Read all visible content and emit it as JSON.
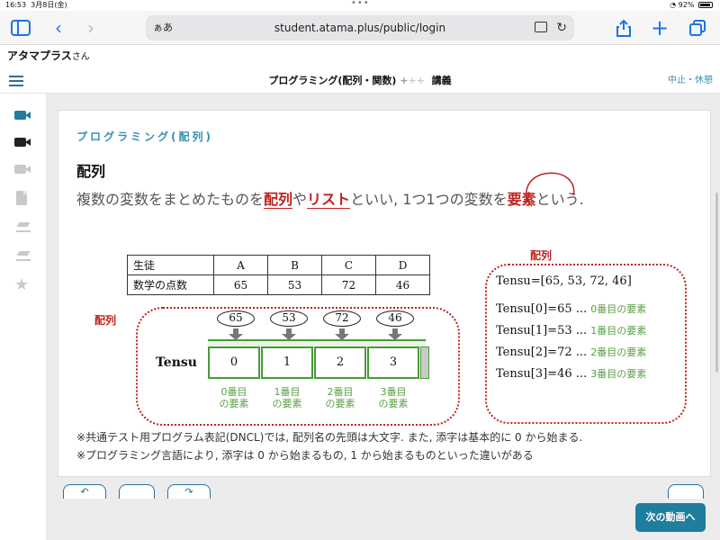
{
  "status_bar": {
    "time": "16:53",
    "date": "3月8日(金)",
    "battery": "92%"
  },
  "browser": {
    "aa_label": "ぁあ",
    "url": "student.atama.plus/public/login"
  },
  "user": {
    "name": "アタマプラス",
    "suffix": "さん"
  },
  "header": {
    "title": "プログラミング(配列・関数)",
    "plus1": "+",
    "plus2": "++",
    "type": "講義",
    "pause_label": "中止・休憩"
  },
  "content": {
    "section_label": "プログラミング(配列)",
    "heading": "配列",
    "sentence": {
      "p1": "複数の変数をまとめたものを",
      "array": "配列",
      "p2": "や",
      "list": "リスト",
      "p3": "といい, 1つ1つの変数を",
      "element": "要素",
      "p4": "という."
    },
    "table": {
      "row_label_1": "生徒",
      "row_label_2": "数学の点数",
      "students": [
        "A",
        "B",
        "C",
        "D"
      ],
      "scores": [
        "65",
        "53",
        "72",
        "46"
      ]
    },
    "array_tag_left": "配列",
    "array_tag_right": "配列",
    "array_name": "Tensu",
    "values": [
      "65",
      "53",
      "72",
      "46"
    ],
    "indices": [
      "0",
      "1",
      "2",
      "3"
    ],
    "element_labels": [
      {
        "line1": "0番目",
        "line2": "の要素"
      },
      {
        "line1": "1番目",
        "line2": "の要素"
      },
      {
        "line1": "2番目",
        "line2": "の要素"
      },
      {
        "line1": "3番目",
        "line2": "の要素"
      }
    ],
    "code_decl": "Tensu=[65, 53, 72, 46]",
    "code_lines": [
      {
        "expr": "Tensu[0]=65 ...",
        "label": "0番目の要素"
      },
      {
        "expr": "Tensu[1]=53 ...",
        "label": "1番目の要素"
      },
      {
        "expr": "Tensu[2]=72 ...",
        "label": "2番目の要素"
      },
      {
        "expr": "Tensu[3]=46 ...",
        "label": "3番目の要素"
      }
    ],
    "note1": "※共通テスト用プログラム表記(DNCL)では, 配列名の先頭は大文字. また, 添字は基本的に 0 から始まる.",
    "note2": "※プログラミング言語により, 添字は 0 から始まるもの, 1 から始まるものといった違いがある"
  },
  "controls": {
    "next_video": "次の動画へ"
  },
  "colors": {
    "accent": "#3591b5",
    "red": "#c0221f",
    "green": "#5aa046",
    "button": "#1f7d9e"
  }
}
